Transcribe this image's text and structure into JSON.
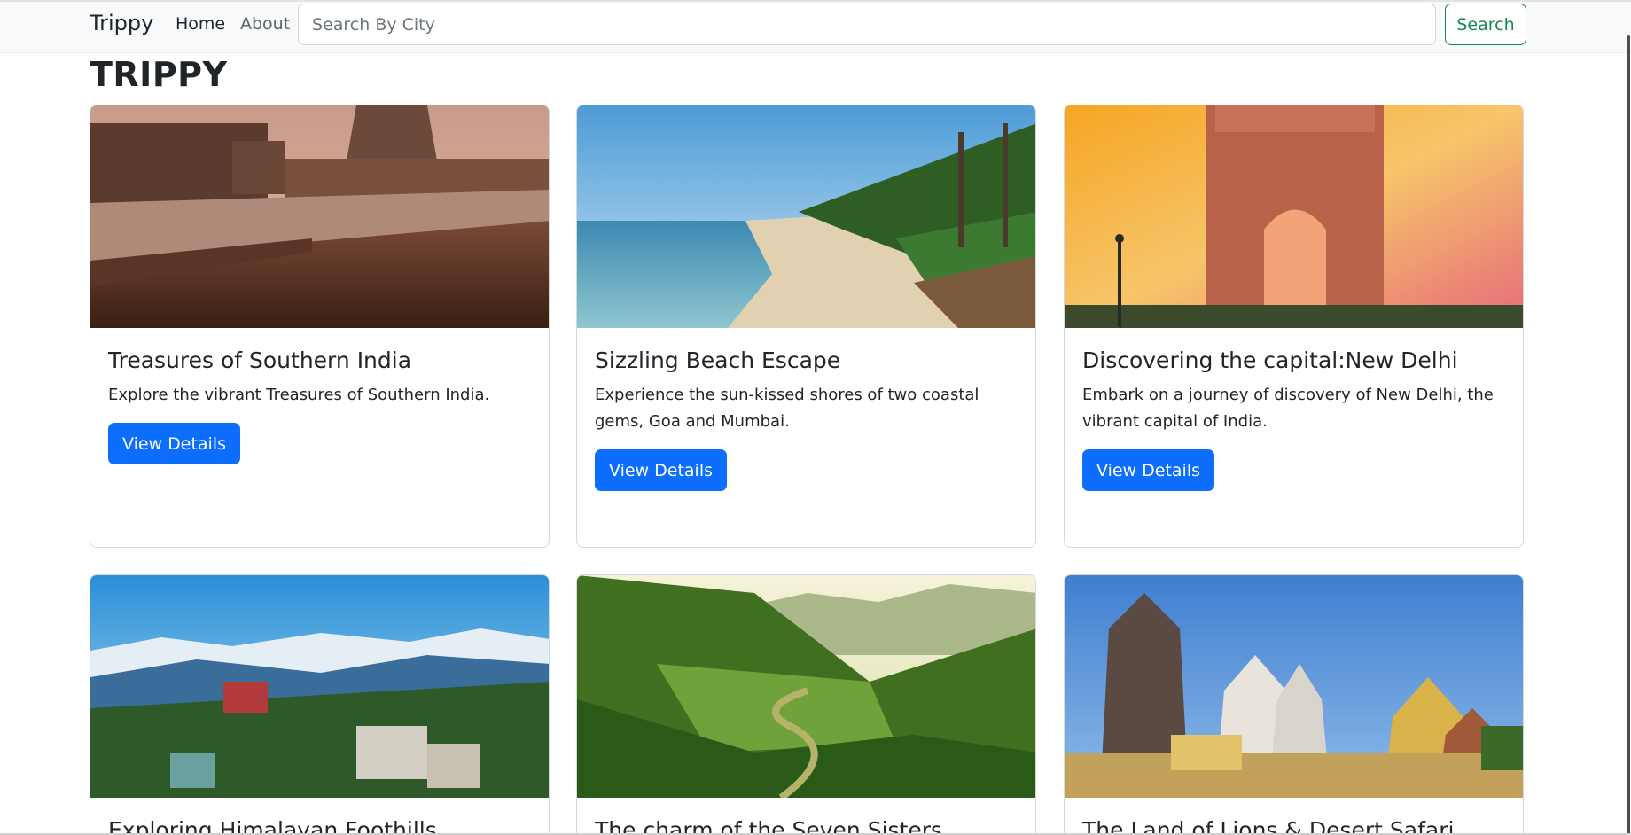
{
  "navbar": {
    "brand": "Trippy",
    "links": [
      {
        "label": "Home"
      },
      {
        "label": "About"
      }
    ],
    "search_placeholder": "Search By City",
    "search_button": "Search"
  },
  "page": {
    "title": "TRIPPY"
  },
  "cards": [
    {
      "title": "Treasures of Southern India",
      "text": "Explore the vibrant Treasures of Southern India.",
      "button": "View Details",
      "image": "temple-tank-photo"
    },
    {
      "title": "Sizzling Beach Escape",
      "text": "Experience the sun-kissed shores of two coastal gems, Goa and Mumbai.",
      "button": "View Details",
      "image": "beach-photo"
    },
    {
      "title": "Discovering the capital:New Delhi",
      "text": "Embark on a journey of discovery of New Delhi, the vibrant capital of India.",
      "button": "View Details",
      "image": "india-gate-photo"
    },
    {
      "title": "Exploring Himalayan Foothills",
      "image": "mountain-town-photo"
    },
    {
      "title": "The charm of the Seven Sisters",
      "image": "green-valley-photo"
    },
    {
      "title": "The Land of Lions & Desert Safari",
      "image": "temple-complex-photo"
    }
  ]
}
